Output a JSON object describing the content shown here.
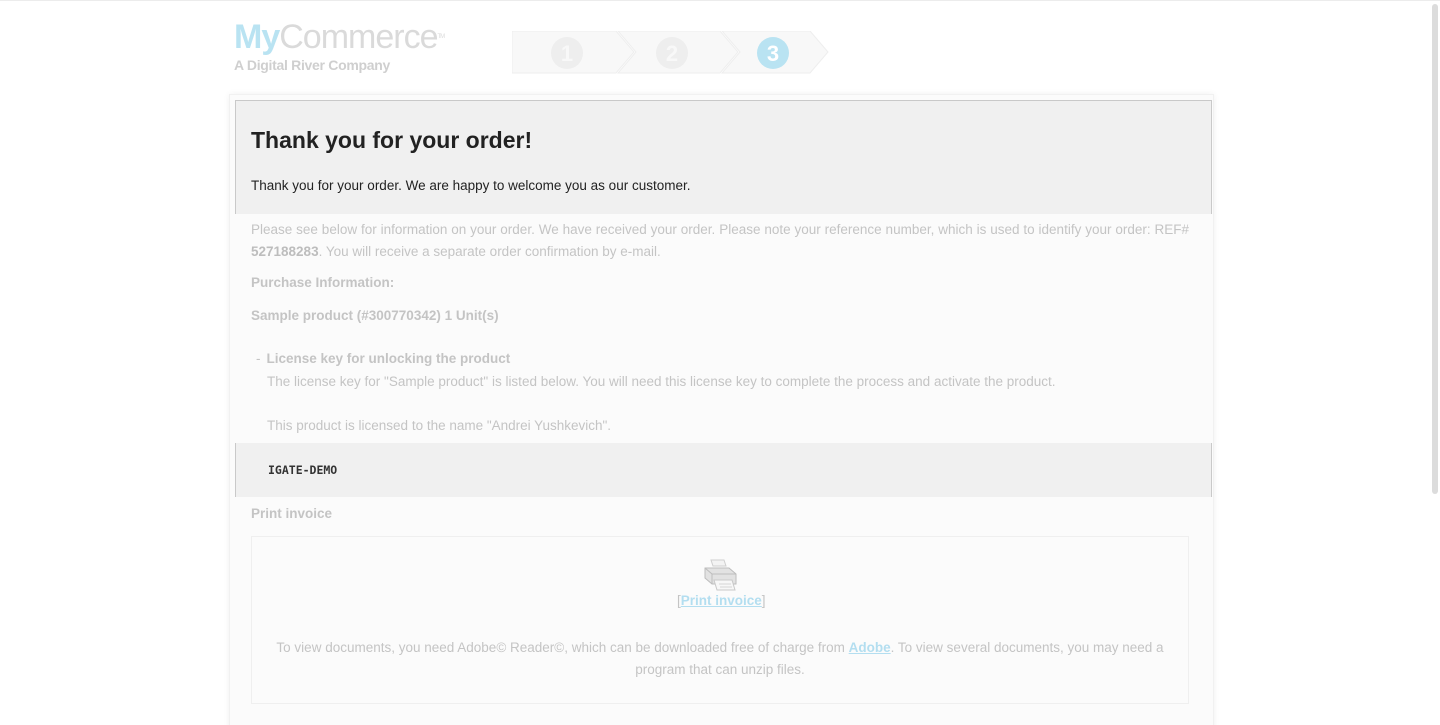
{
  "header": {
    "logo_my": "My",
    "logo_commerce": "Commerce",
    "logo_tm": "TM",
    "logo_subtitle": "A Digital River Company",
    "steps": [
      "1",
      "2",
      "3"
    ],
    "active_step": 3,
    "colors": {
      "active_step": "#b9e3f2",
      "inactive_step": "#eeeeee"
    }
  },
  "main": {
    "title": "Thank you for your order!",
    "welcome": "Thank you for your order. We are happy to welcome you as our customer.",
    "info_text": "Please see below for information on your order. We have received your order. Please note your reference number, which is used to identify your order: REF#",
    "ref_number": "527188283",
    "info_text_after": ". You will receive a separate order confirmation by e-mail.",
    "purchase_label": "Purchase Information:",
    "product_line": "Sample product (#300770342) 1 Unit(s)",
    "bullet": "-",
    "license_heading": "License key for unlocking the product",
    "license_desc": "The license key for \"Sample product\" is listed below. You will need this license key to complete the process and activate the product.",
    "licensed_to": "This product is licensed to the name \"Andrei Yushkevich\".",
    "license_key": "IGATE-DEMO",
    "print_section_label": "Print invoice",
    "printer_icon": "printer-icon",
    "print_bracket_open": "[",
    "print_link": "Print invoice",
    "print_bracket_close": "]",
    "docs_note_before": "To view documents, you need Adobe© Reader©, which can be downloaded free of charge from ",
    "docs_link": "Adobe",
    "docs_note_after": ". To view several documents, you may need a program that can unzip files."
  }
}
